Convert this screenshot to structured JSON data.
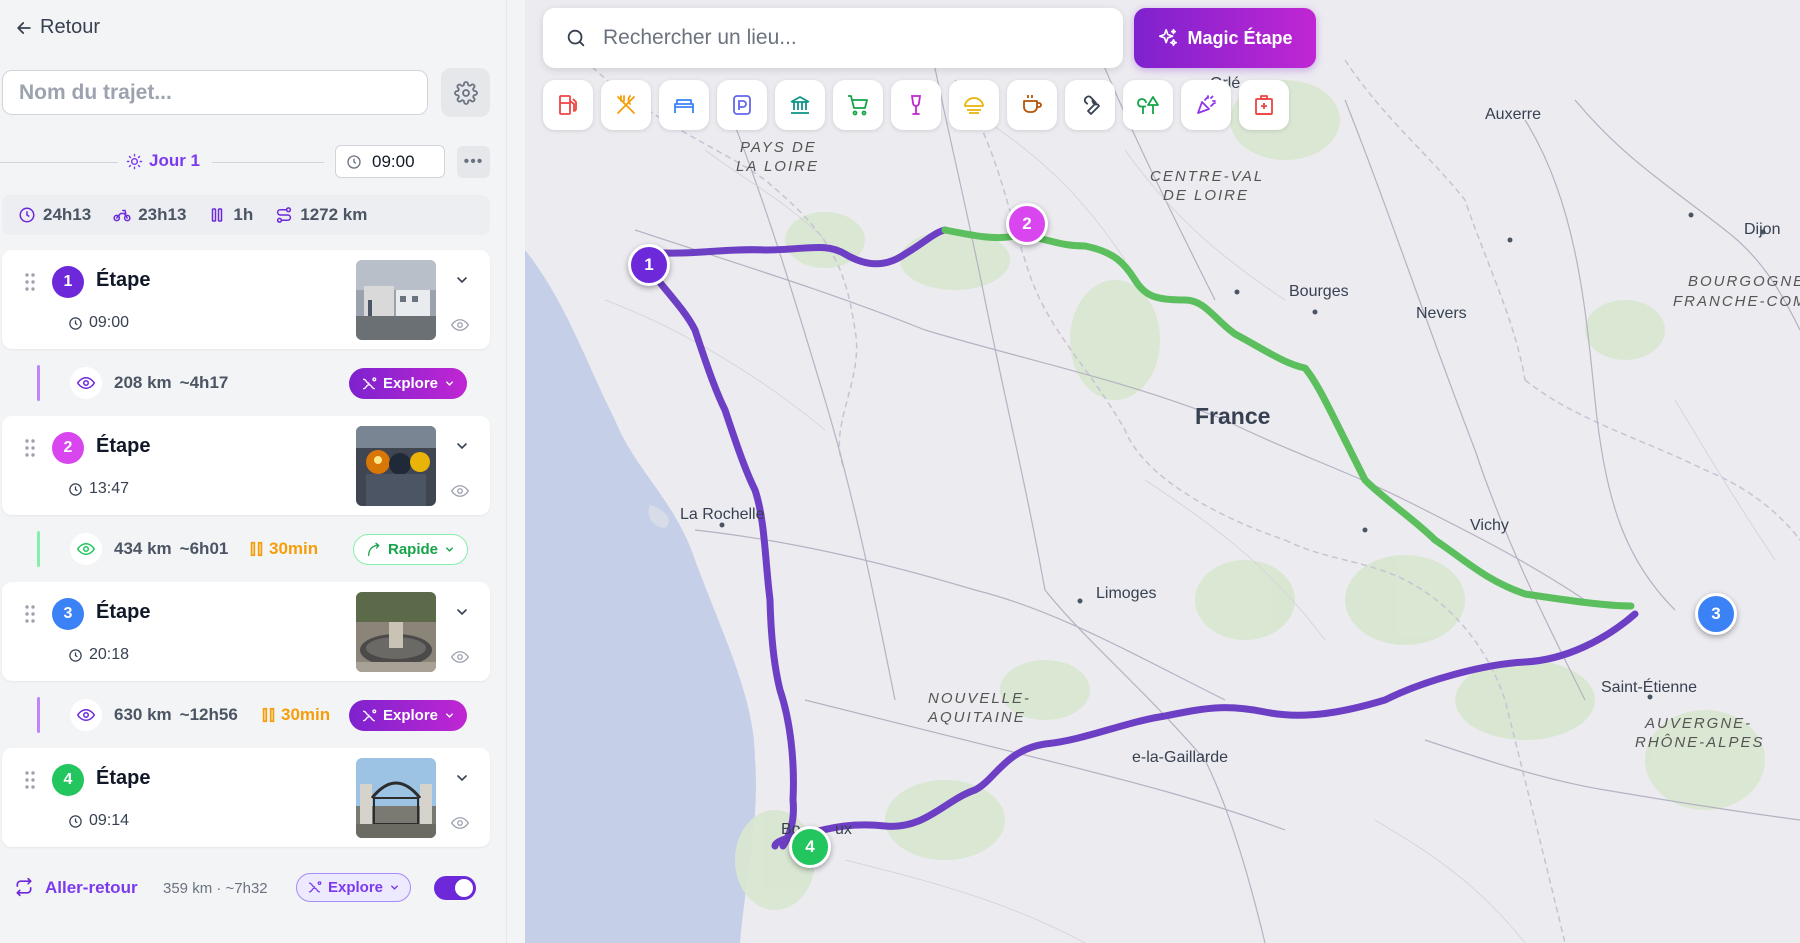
{
  "colors": {
    "primary": "#6d28d9",
    "step1": "#6d28d9",
    "step2": "#d946ef",
    "step3": "#3b82f6",
    "step4": "#22c55e",
    "route_purple": "#6d3fc4",
    "route_green": "#5cbf5e",
    "pause": "#f59e0b"
  },
  "sidebar": {
    "back_label": "Retour",
    "name_placeholder": "Nom du trajet...",
    "day_label": "Jour 1",
    "start_time": "09:00",
    "stats": {
      "total_duration": "24h13",
      "ride_duration": "23h13",
      "pause_duration": "1h",
      "distance": "1272 km"
    },
    "steps": [
      {
        "number": "1",
        "title": "Étape",
        "time": "09:00",
        "color": "#6d28d9"
      },
      {
        "number": "2",
        "title": "Étape",
        "time": "13:47",
        "color": "#d946ef"
      },
      {
        "number": "3",
        "title": "Étape",
        "time": "20:18",
        "color": "#3b82f6"
      },
      {
        "number": "4",
        "title": "Étape",
        "time": "09:14",
        "color": "#22c55e"
      }
    ],
    "segments": [
      {
        "distance": "208 km",
        "duration": "~4h17",
        "pause": "",
        "mode": "Explore"
      },
      {
        "distance": "434 km",
        "duration": "~6h01",
        "pause": "30min",
        "mode": "Rapide"
      },
      {
        "distance": "630 km",
        "duration": "~12h56",
        "pause": "30min",
        "mode": "Explore"
      }
    ],
    "round_trip": {
      "label": "Aller-retour",
      "meta": "359 km · ~7h32",
      "mode": "Explore",
      "enabled": true
    }
  },
  "map": {
    "search_placeholder": "Rechercher un lieu...",
    "magic_label": "Magic Étape",
    "categories": [
      "fuel-icon",
      "restaurant-icon",
      "hotel-icon",
      "parking-icon",
      "museum-icon",
      "shopping-icon",
      "wine-icon",
      "picnic-icon",
      "cafe-icon",
      "repair-icon",
      "nature-icon",
      "entertainment-icon",
      "hospital-icon"
    ],
    "labels": {
      "region_pdl_1": "PAYS DE",
      "region_pdl_2": "LA LOIRE",
      "region_cvl_1": "CENTRE-VAL",
      "region_cvl_2": "DE LOIRE",
      "region_bfc_1": "BOURGOGNE-",
      "region_bfc_2": "FRANCHE-COM",
      "region_na_1": "NOUVELLE-",
      "region_na_2": "AQUITAINE",
      "region_ara_1": "AUVERGNE-",
      "region_ara_2": "RHÔNE-ALPES",
      "country": "France",
      "city_auxerre": "Auxerre",
      "city_dijon": "Dijon",
      "city_bourges": "Bourges",
      "city_nevers": "Nevers",
      "city_larochelle": "La Rochelle",
      "city_vichy": "Vichy",
      "city_limoges": "Limoges",
      "city_saintetienne": "Saint-Étienne",
      "city_gaillarde": "e-la-Gaillarde",
      "city_bordeaux_1": "Bo",
      "city_bordeaux_2": "ux",
      "city_orleans": "Orlé"
    }
  }
}
